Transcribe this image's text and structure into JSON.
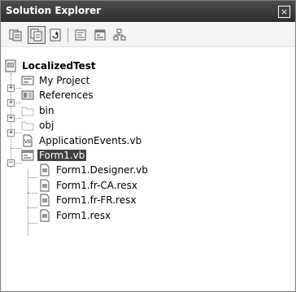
{
  "panel": {
    "title": "Solution Explorer",
    "close_glyph": "×"
  },
  "toolbar": {
    "buttons": [
      {
        "name": "properties-icon"
      },
      {
        "name": "show-all-files-icon"
      },
      {
        "name": "refresh-icon"
      },
      {
        "name": "view-code-icon"
      },
      {
        "name": "view-designer-icon"
      },
      {
        "name": "class-view-icon"
      }
    ]
  },
  "tree": {
    "root": "LocalizedTest",
    "items": [
      {
        "label": "My Project"
      },
      {
        "label": "References"
      },
      {
        "label": "bin"
      },
      {
        "label": "obj"
      },
      {
        "label": "ApplicationEvents.vb"
      },
      {
        "label": "Form1.vb"
      }
    ],
    "children": [
      {
        "label": "Form1.Designer.vb"
      },
      {
        "label": "Form1.fr-CA.resx"
      },
      {
        "label": "Form1.fr-FR.resx"
      },
      {
        "label": "Form1.resx"
      }
    ],
    "expander": {
      "plus": "+",
      "minus": "−"
    }
  },
  "colors": {
    "titlebar": "#3a3a3a",
    "selection": "#404040"
  }
}
